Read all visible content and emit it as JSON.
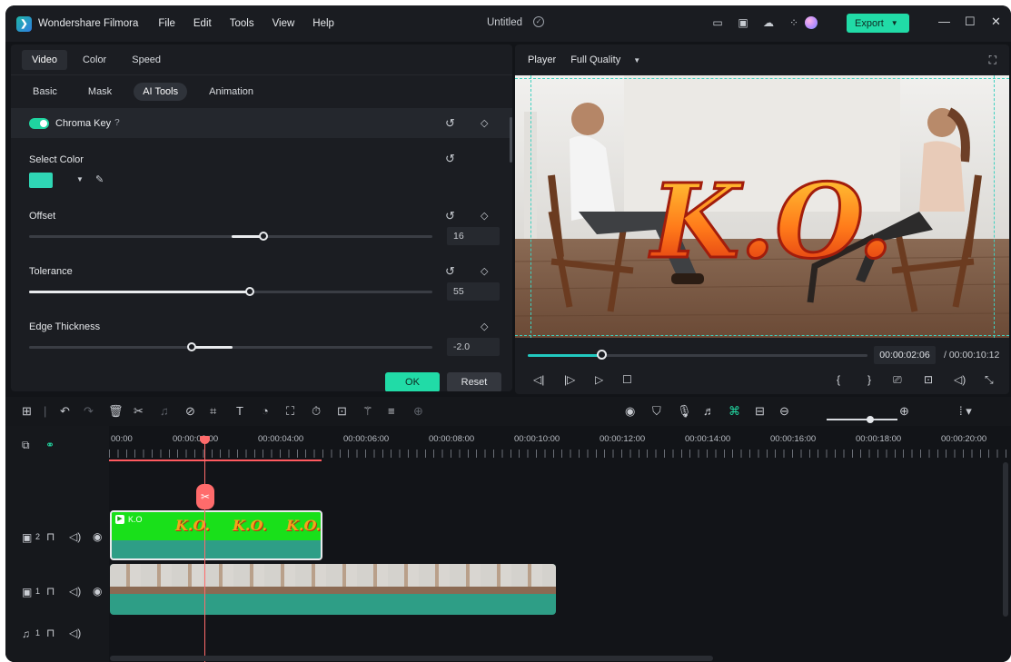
{
  "titlebar": {
    "app_name": "Wondershare Filmora",
    "menu": [
      "File",
      "Edit",
      "Tools",
      "View",
      "Help"
    ],
    "document_title": "Untitled",
    "export_label": "Export"
  },
  "left_panel": {
    "tabs": [
      "Video",
      "Color",
      "Speed"
    ],
    "active_tab": "Video",
    "subtabs": [
      "Basic",
      "Mask",
      "AI Tools",
      "Animation"
    ],
    "active_subtab": "AI Tools",
    "chroma_key_label": "Chroma Key",
    "chroma_key_enabled": true,
    "select_color_label": "Select Color",
    "selected_color": "#2fd6b5",
    "offset": {
      "label": "Offset",
      "value": "16",
      "fraction": 0.58
    },
    "tolerance": {
      "label": "Tolerance",
      "value": "55",
      "fraction": 0.55
    },
    "edge_thickness": {
      "label": "Edge Thickness",
      "value": "-2.0",
      "fraction": 0.4
    },
    "ok_label": "OK",
    "reset_label": "Reset"
  },
  "player": {
    "label": "Player",
    "quality": "Full Quality",
    "overlay_text": "K.O.",
    "progress": 0.2,
    "current_time": "00:00:02:06",
    "total_time": "/ 00:00:10:12"
  },
  "timeline": {
    "ruler_labels": [
      "00:00",
      "00:00:02:00",
      "00:00:04:00",
      "00:00:06:00",
      "00:00:08:00",
      "00:00:10:00",
      "00:00:12:00",
      "00:00:14:00",
      "00:00:16:00",
      "00:00:18:00",
      "00:00:20:00"
    ],
    "tracks": [
      {
        "number": "2",
        "type": "video"
      },
      {
        "number": "1",
        "type": "video"
      },
      {
        "number": "1",
        "type": "audio"
      }
    ],
    "ko_clip_name": "K.O",
    "ko_thumb_text": "K.O."
  },
  "colors": {
    "accent": "#21dba7",
    "background": "#121418",
    "panel": "#1b1d22",
    "playhead": "#ff6b6b",
    "clip_green": "#19e01a",
    "clip_teal": "#2e9e86"
  }
}
